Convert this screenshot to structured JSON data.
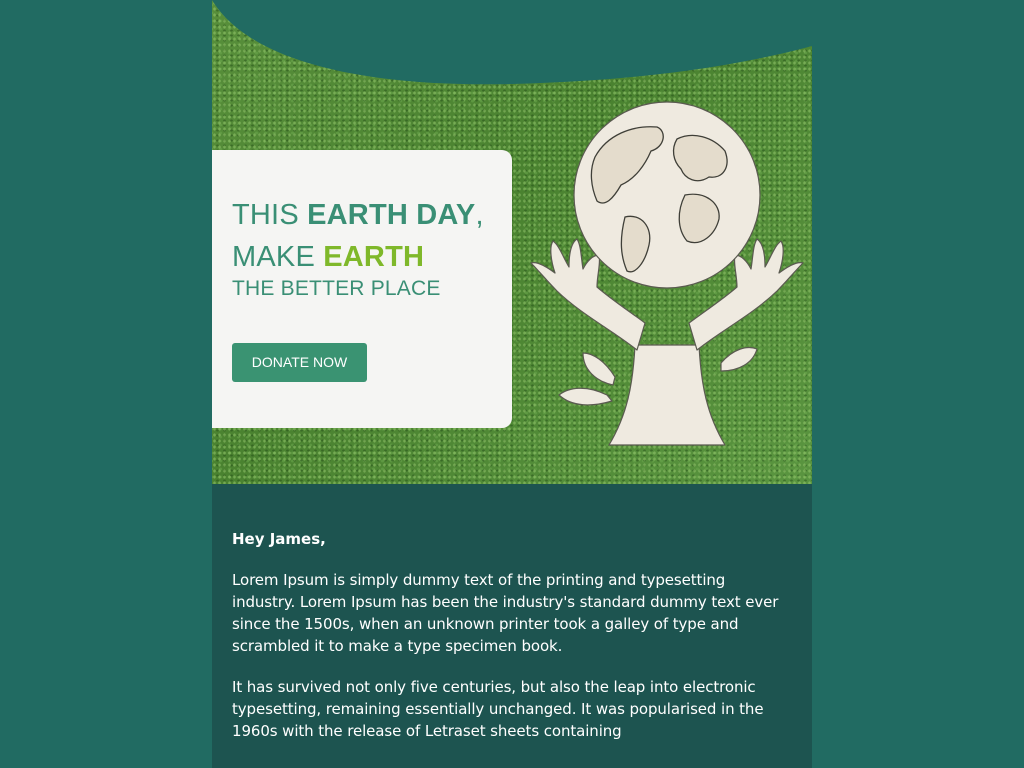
{
  "hero": {
    "headline_this": "THIS ",
    "headline_earth_day": "EARTH DAY",
    "headline_comma": ",",
    "headline_make": "MAKE ",
    "headline_earth": "EARTH",
    "subheadline": "THE BETTER PLACE",
    "donate_label": "DONATE NOW",
    "illustration_icon": "globe-in-hands-tree-icon"
  },
  "body": {
    "greeting": "Hey James,",
    "paragraph_1": "Lorem Ipsum is simply dummy text of the printing and typesetting industry. Lorem Ipsum has been the industry's standard dummy text ever since the 1500s, when an unknown printer took a galley of type and scrambled it to make a type specimen book.",
    "paragraph_2": "It has survived not only five centuries, but also the leap into electronic typesetting, remaining essentially unchanged. It was popularised in the 1960s with the release of Letraset sheets containing"
  },
  "colors": {
    "page_background": "#216b62",
    "body_panel": "#1d5450",
    "card_background": "#f5f5f3",
    "headline_green": "#3a8f75",
    "accent_lime": "#7fb82a",
    "button": "#3a9372"
  }
}
